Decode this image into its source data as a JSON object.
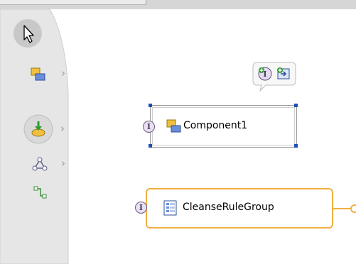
{
  "palette": {
    "items": [
      {
        "icon": "selection-arrow-icon"
      },
      {
        "icon": "component-tool-icon",
        "has_submenu": true
      },
      {
        "icon": "import-tool-icon",
        "has_submenu": true,
        "selected": true
      },
      {
        "icon": "wire-tool-icon",
        "has_submenu": true
      },
      {
        "icon": "connection-tool-icon",
        "has_submenu": false
      }
    ]
  },
  "diagram": {
    "component": {
      "label": "Component1",
      "selected": true
    },
    "rule_group": {
      "label": "CleanseRuleGroup"
    },
    "action_bar": [
      {
        "icon": "add-interface-icon"
      },
      {
        "icon": "add-reference-icon"
      }
    ],
    "colors": {
      "selection_handle": "#1f4fb4",
      "rule_group_border": "#f0b040",
      "palette_bg": "#e8e8e8"
    }
  }
}
